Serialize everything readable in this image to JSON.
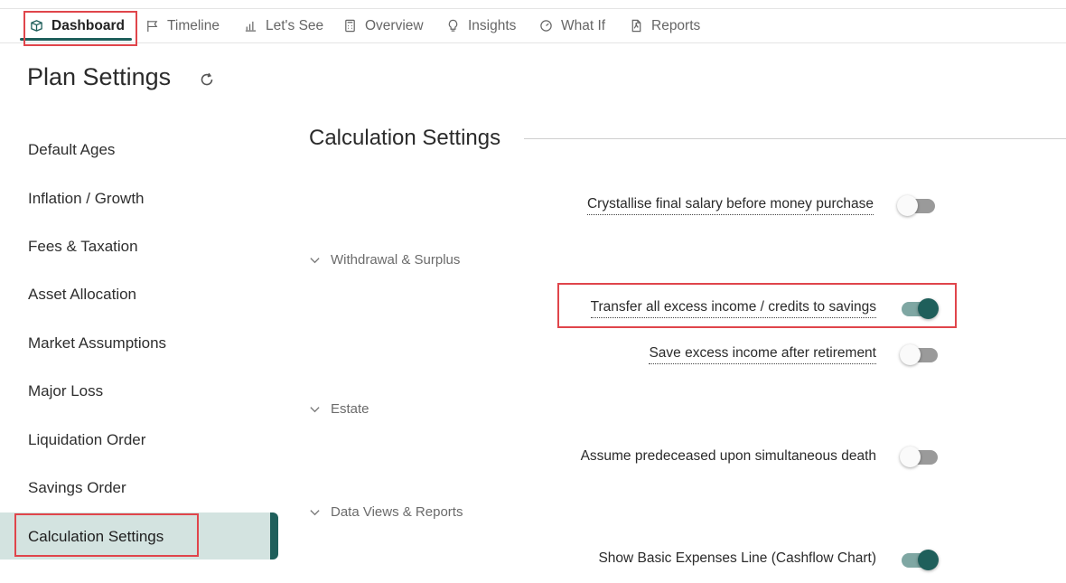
{
  "nav": {
    "tabs": [
      {
        "label": "Dashboard",
        "icon": "box-icon",
        "active": true
      },
      {
        "label": "Timeline",
        "icon": "flag-icon"
      },
      {
        "label": "Let's See",
        "icon": "bar-chart-icon"
      },
      {
        "label": "Overview",
        "icon": "calculator-icon"
      },
      {
        "label": "Insights",
        "icon": "lightbulb-icon"
      },
      {
        "label": "What If",
        "icon": "gauge-icon"
      },
      {
        "label": "Reports",
        "icon": "pdf-file-icon"
      }
    ]
  },
  "page": {
    "title": "Plan Settings",
    "refresh_icon": "refresh-icon"
  },
  "sidebar": {
    "items": [
      {
        "label": "Default Ages"
      },
      {
        "label": "Inflation / Growth"
      },
      {
        "label": "Fees & Taxation"
      },
      {
        "label": "Asset Allocation"
      },
      {
        "label": "Market Assumptions"
      },
      {
        "label": "Major Loss"
      },
      {
        "label": "Liquidation Order"
      },
      {
        "label": "Savings Order"
      },
      {
        "label": "Calculation Settings",
        "active": true
      }
    ]
  },
  "content": {
    "title": "Calculation Settings",
    "options": [
      {
        "label": "Crystallise final salary before money purchase",
        "enabled": false
      },
      {
        "label": "Transfer all excess income / credits to savings",
        "enabled": true
      },
      {
        "label": "Save excess income after retirement",
        "enabled": false
      },
      {
        "label": "Assume predeceased upon simultaneous death",
        "enabled": false
      },
      {
        "label": "Show Basic Expenses Line (Cashflow Chart)",
        "enabled": true
      }
    ],
    "groups": [
      {
        "label": "Withdrawal & Surplus"
      },
      {
        "label": "Estate"
      },
      {
        "label": "Data Views & Reports"
      }
    ]
  },
  "colors": {
    "accent": "#1f5f5b",
    "highlight": "#e0454b",
    "active_bg": "#d3e3e0"
  }
}
